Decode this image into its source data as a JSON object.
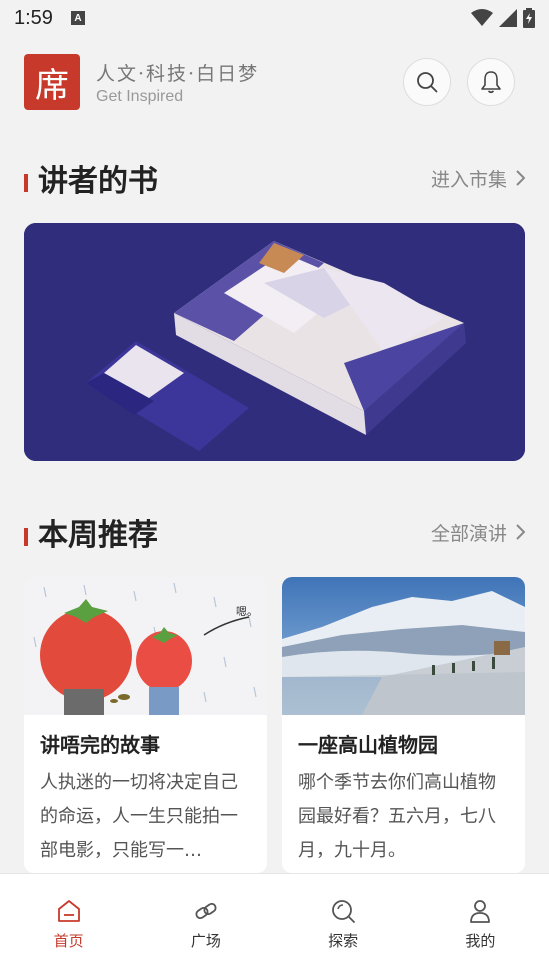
{
  "status": {
    "time": "1:59",
    "a_badge": "A"
  },
  "header": {
    "logo_char": "席",
    "slogan_cn": "人文·科技·白日梦",
    "slogan_en": "Get Inspired",
    "search_icon": "search-icon",
    "bell_icon": "bell-icon"
  },
  "section_books": {
    "title": "讲者的书",
    "more": "进入市集"
  },
  "section_weekly": {
    "title": "本周推荐",
    "more": "全部演讲"
  },
  "cards": [
    {
      "title": "讲唔完的故事",
      "desc": "人执迷的一切将决定自己的命运，人一生只能拍一部电影，只能写一…",
      "bubble": "嗯。"
    },
    {
      "title": "一座高山植物园",
      "desc": "哪个季节去你们高山植物园最好看？五六月，七八月，九十月。"
    }
  ],
  "nav": [
    {
      "label": "首页",
      "icon": "home-icon",
      "active": true
    },
    {
      "label": "广场",
      "icon": "link-icon",
      "active": false
    },
    {
      "label": "探索",
      "icon": "explore-icon",
      "active": false
    },
    {
      "label": "我的",
      "icon": "profile-icon",
      "active": false
    }
  ],
  "colors": {
    "accent": "#c73a2b",
    "banner_bg": "#2f2c7a"
  }
}
